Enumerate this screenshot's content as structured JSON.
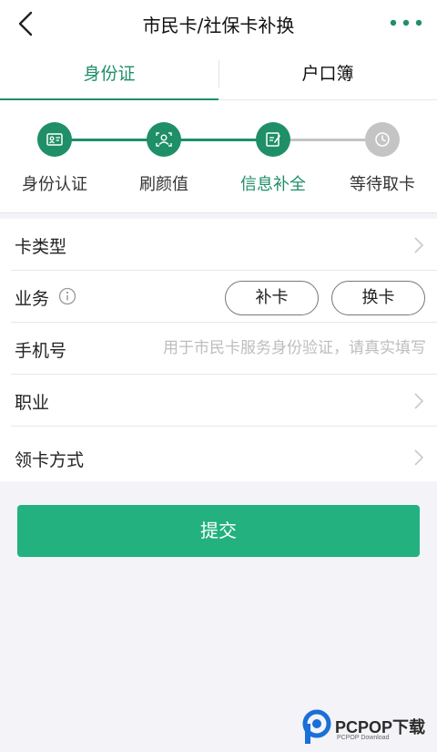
{
  "header": {
    "title": "市民卡/社保卡补换"
  },
  "tabs": [
    {
      "label": "身份证"
    },
    {
      "label": "户口簿"
    }
  ],
  "steps": [
    {
      "label": "身份认证"
    },
    {
      "label": "刷颜值"
    },
    {
      "label": "信息补全"
    },
    {
      "label": "等待取卡"
    }
  ],
  "form": {
    "card_type_label": "卡类型",
    "business_label": "业务",
    "business_options": [
      "补卡",
      "换卡"
    ],
    "phone_label": "手机号",
    "phone_placeholder": "用于市民卡服务身份验证，请真实填写",
    "occupation_label": "职业",
    "pickup_label": "领卡方式"
  },
  "submit_label": "提交",
  "watermark": {
    "brand": "PCPOP下载",
    "sub": "PCPOP Download"
  },
  "colors": {
    "accent": "#1f8f68",
    "button": "#22b17f",
    "inactive": "#c4c4c4"
  }
}
